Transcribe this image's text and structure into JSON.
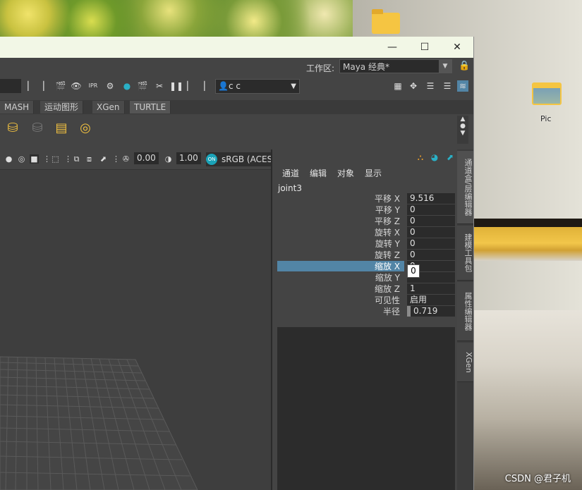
{
  "desktop": {
    "pic_label": "Pic",
    "watermark": "CSDN @君子机"
  },
  "window": {
    "controls": {
      "minimize": "—",
      "maximize": "☐",
      "close": "✕"
    }
  },
  "workspace": {
    "label": "工作区:",
    "value": "Maya 经典*"
  },
  "toolbar": {
    "camera_select": "c c"
  },
  "shelf_tabs": [
    "MASH",
    "运动图形",
    "XGen",
    "TURTLE"
  ],
  "viewport": {
    "exposure": "0.00",
    "gamma": "1.00",
    "colorspace": "sRGB (ACES",
    "on_badge": "ON"
  },
  "channel_box": {
    "menu": [
      "通道",
      "编辑",
      "对象",
      "显示"
    ],
    "node_name": "joint3",
    "attributes": [
      {
        "label": "平移 X",
        "value": "9.516"
      },
      {
        "label": "平移 Y",
        "value": "0"
      },
      {
        "label": "平移 Z",
        "value": "0"
      },
      {
        "label": "旋转 X",
        "value": "0"
      },
      {
        "label": "旋转 Y",
        "value": "0"
      },
      {
        "label": "旋转 Z",
        "value": "0"
      },
      {
        "label": "缩放 X",
        "value": "0"
      },
      {
        "label": "缩放 Y",
        "value": ""
      },
      {
        "label": "缩放 Z",
        "value": "1"
      },
      {
        "label": "可见性",
        "value": "启用"
      },
      {
        "label": "半径",
        "value": "0.719"
      }
    ],
    "tooltip_value": "0"
  },
  "side_tabs": [
    "通道盒/层编辑器",
    "建模工具包",
    "属性编辑器",
    "XGen"
  ],
  "colors": {
    "maya_panel": "#444444",
    "selection": "#5285a6",
    "field": "#2b2b2b",
    "titlebar": "#f2f7e6"
  }
}
